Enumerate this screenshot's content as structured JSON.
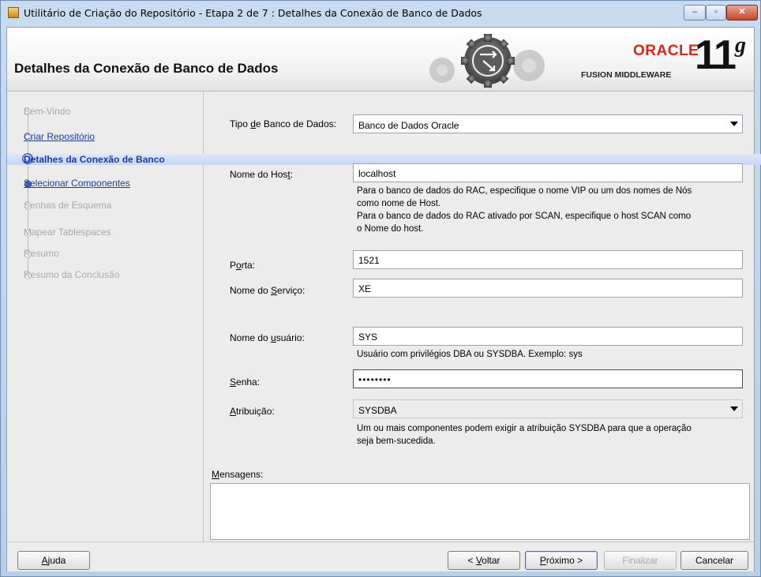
{
  "window": {
    "title": "Utilitário de Criação do Repositório - Etapa 2 de 7 : Detalhes da Conexão de Banco de Dados",
    "minimize_glyph": "–",
    "maximize_glyph": "▫",
    "close_glyph": "✕"
  },
  "header": {
    "title": "Detalhes da Conexão de Banco de Dados",
    "brand": "ORACLE",
    "product": "FUSION MIDDLEWARE",
    "version": "11",
    "version_suffix": "g"
  },
  "steps": [
    {
      "label": "Bem-Vindo",
      "state": "disabled"
    },
    {
      "label": "Criar Repositório",
      "state": "link"
    },
    {
      "label": "Detalhes da Conexão de Banco",
      "state": "current"
    },
    {
      "label": "Selecionar Componentes",
      "state": "link"
    },
    {
      "label": "Senhas de Esquema",
      "state": "disabled"
    },
    {
      "label": "Mapear Tablespaces",
      "state": "disabled"
    },
    {
      "label": "Resumo",
      "state": "disabled"
    },
    {
      "label": "Resumo da Conclusão",
      "state": "disabled"
    }
  ],
  "form": {
    "db_type_label": {
      "pre": "Tipo ",
      "u": "d",
      "post": "e Banco de Dados:"
    },
    "db_type_value": "Banco de Dados Oracle",
    "host_label": {
      "pre": "Nome do Hos",
      "u": "t",
      "post": ":"
    },
    "host_value": "localhost",
    "host_hint_1": "Para o banco de dados do RAC, especifique o nome VIP ou um dos nomes de Nós",
    "host_hint_2": "como nome de Host.",
    "host_hint_3": "Para o banco de dados do RAC ativado por SCAN, especifique o host SCAN como",
    "host_hint_4": "o Nome do host.",
    "port_label": {
      "pre": "P",
      "u": "o",
      "post": "rta:"
    },
    "port_value": "1521",
    "service_label": {
      "pre": "Nome do ",
      "u": "S",
      "post": "erviço:"
    },
    "service_value": "XE",
    "user_label": {
      "pre": "Nome do ",
      "u": "u",
      "post": "suário:"
    },
    "user_value": "SYS",
    "user_hint": "Usuário com privilégios DBA ou SYSDBA. Exemplo: sys",
    "password_label": {
      "pre": "",
      "u": "S",
      "post": "enha:"
    },
    "password_value": "••••••••",
    "role_label": {
      "pre": "",
      "u": "A",
      "post": "tribuição:"
    },
    "role_value": "SYSDBA",
    "role_hint_1": "Um ou mais componentes podem exigir a atribuição SYSDBA para que a operação",
    "role_hint_2": "seja bem-sucedida.",
    "messages_label": {
      "pre": "",
      "u": "M",
      "post": "ensagens:"
    }
  },
  "buttons": {
    "help": {
      "pre": "",
      "u": "A",
      "post": "juda"
    },
    "back": {
      "pre": "< ",
      "u": "V",
      "post": "oltar"
    },
    "next": {
      "pre": "",
      "u": "P",
      "post": "róximo >"
    },
    "finish": "Finalizar",
    "cancel": "Cancelar"
  },
  "colors": {
    "link": "#1b3c9e",
    "brand_red": "#e2231a",
    "highlight_band": "#c8d5f6"
  },
  "icons": [
    "app-icon",
    "gear-graphic",
    "step-circle-icon",
    "dropdown-arrow-icon",
    "scroll-left-icon",
    "scroll-right-icon"
  ]
}
